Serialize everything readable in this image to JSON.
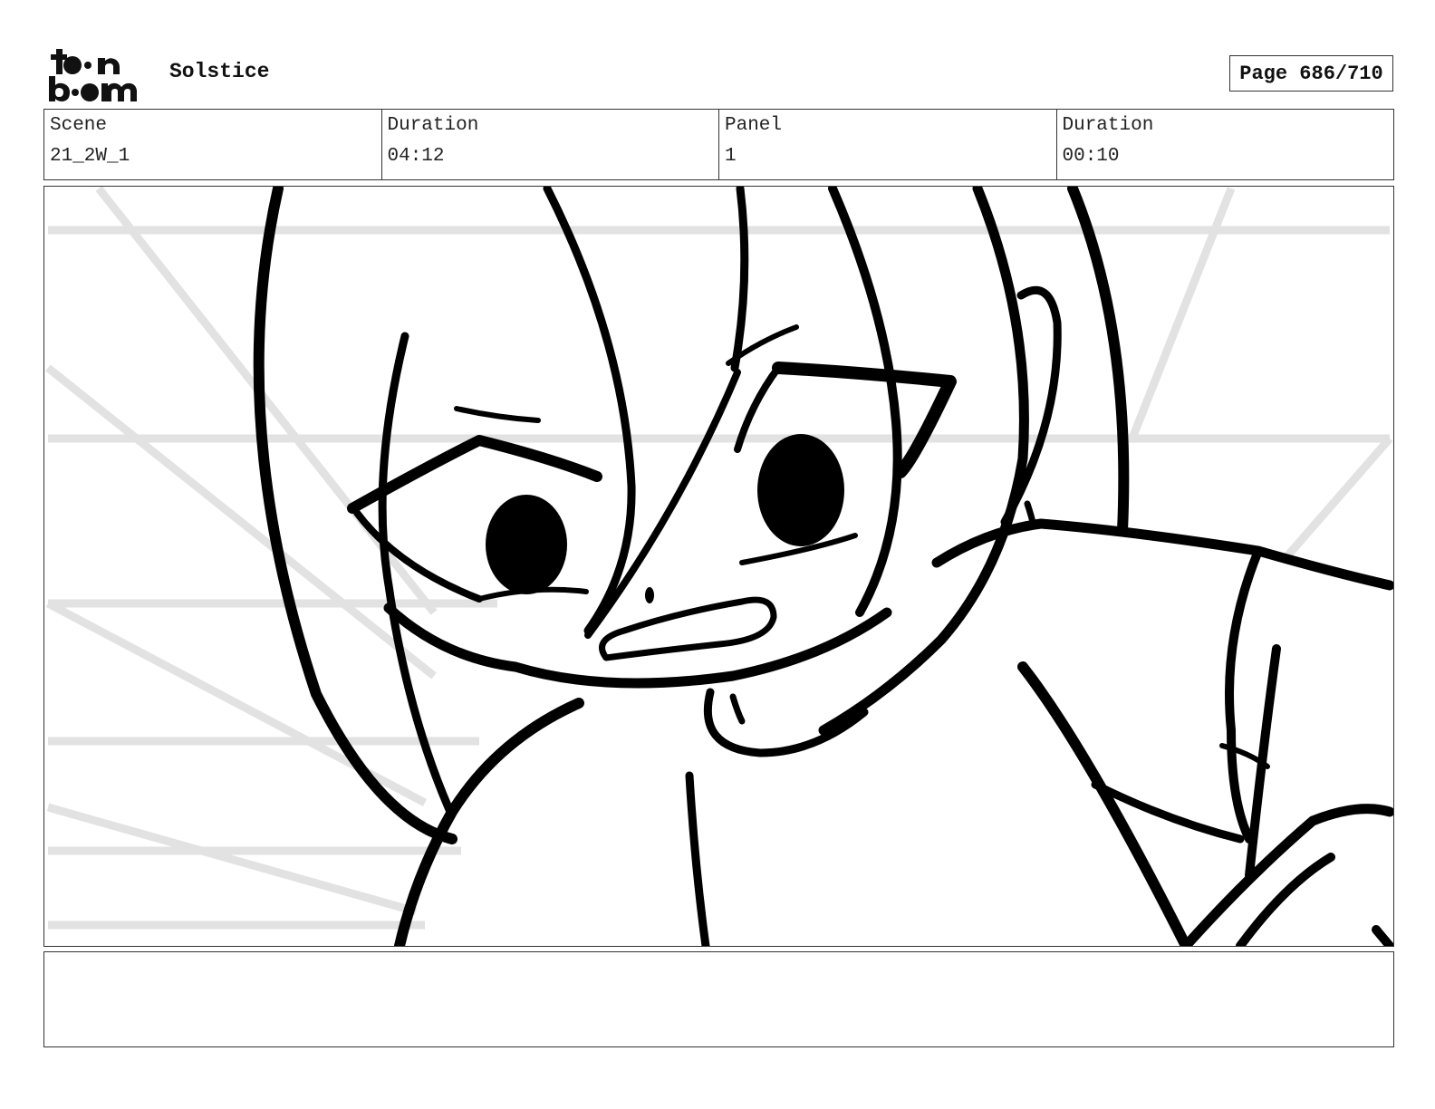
{
  "header": {
    "logo_text": "toon boom",
    "project_title": "Solstice",
    "page_label": "Page 686/710"
  },
  "info": {
    "scene_label": "Scene",
    "scene_value": "21_2W_1",
    "scene_duration_label": "Duration",
    "scene_duration_value": "04:12",
    "panel_label": "Panel",
    "panel_value": "1",
    "panel_duration_label": "Duration",
    "panel_duration_value": "00:10"
  },
  "panel": {
    "illustration": "storyboard-sketch"
  },
  "notes": {
    "text": ""
  },
  "colors": {
    "ink": "#000000",
    "background_lines": "#e2e2e2",
    "border": "#333333"
  }
}
